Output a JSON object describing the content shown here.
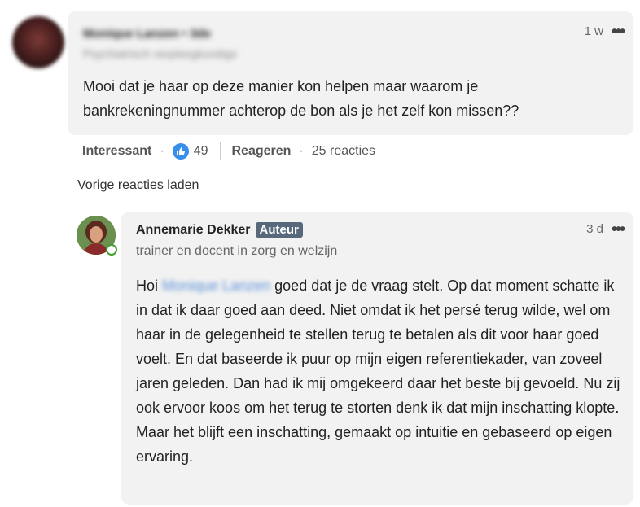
{
  "comment1": {
    "author_name": "Monique Lanzen • 3de",
    "author_subtitle": "Psychiatrisch verpleegkundige",
    "time": "1 w",
    "text": "Mooi dat je haar op deze manier kon helpen maar waarom je bankrekeningnummer achterop de bon als je het zelf kon missen??",
    "actions": {
      "like_label": "Interessant",
      "like_count": "49",
      "reply_label": "Reageren",
      "replies_count": "25 reacties"
    }
  },
  "load_previous": "Vorige reacties laden",
  "comment2": {
    "author_name": "Annemarie Dekker",
    "badge": "Auteur",
    "author_title": "trainer en docent in zorg en welzijn",
    "time": "3 d",
    "greeting": "Hoi",
    "mention": "Monique Lanzen",
    "text": "goed dat je de vraag stelt. Op dat moment schatte ik in dat ik daar goed aan deed. Niet omdat ik het persé terug wilde, wel om haar in de gelegenheid te stellen terug te betalen als dit voor haar goed voelt. En dat baseerde ik puur op mijn eigen referentiekader, van zoveel jaren geleden. Dan had ik mij omgekeerd daar het beste bij gevoeld. Nu zij ook ervoor koos om het terug te storten denk ik dat mijn inschatting klopte. Maar het blijft een inschatting, gemaakt op intuitie en gebaseerd op eigen ervaring."
  },
  "icons": {
    "like": "thumbs-up-icon",
    "more": "more-options-icon",
    "online": "online-status-icon"
  },
  "colors": {
    "like_blue": "#378fe9",
    "online_green": "#44a02e",
    "badge_bg": "#56687a",
    "bubble_bg": "#f2f2f2"
  }
}
